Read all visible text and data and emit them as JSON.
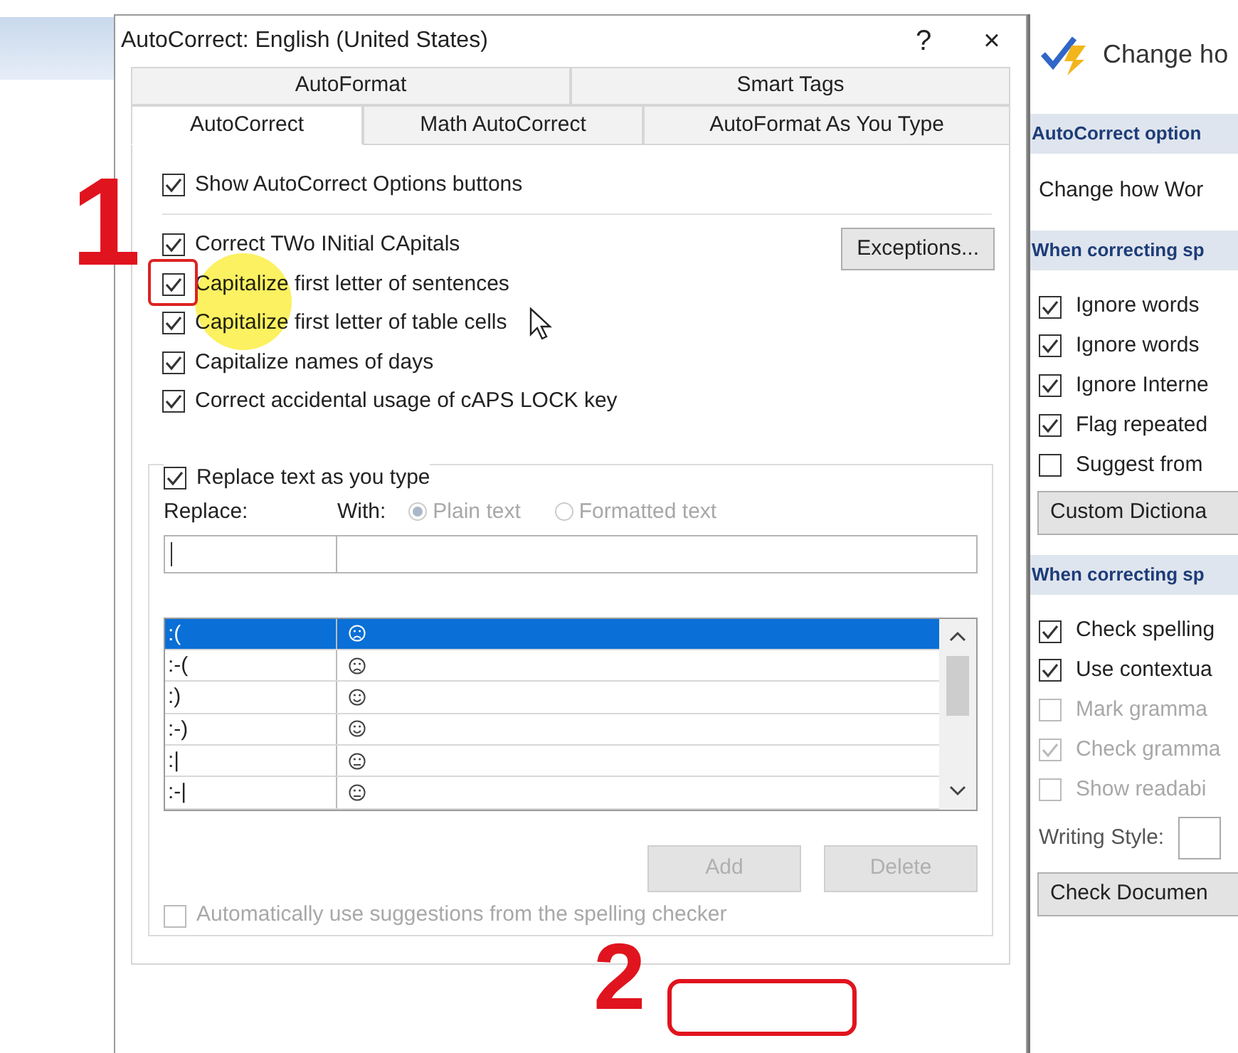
{
  "window": {
    "title": "AutoCorrect: English (United States)",
    "help": "?",
    "close": "×"
  },
  "tabs_back": [
    {
      "label": "AutoFormat",
      "selected": false
    },
    {
      "label": "Smart Tags",
      "selected": false
    }
  ],
  "tabs_front": [
    {
      "label": "AutoCorrect",
      "selected": true
    },
    {
      "label": "Math AutoCorrect",
      "selected": false
    },
    {
      "label": "AutoFormat As You Type",
      "selected": false
    }
  ],
  "show_options": {
    "label": "Show AutoCorrect Options buttons",
    "checked": true
  },
  "options": [
    {
      "label": "Correct TWo INitial CApitals",
      "checked": true,
      "highlighted": false
    },
    {
      "label": "Capitalize first letter of sentences",
      "checked": true,
      "highlighted": true
    },
    {
      "label": "Capitalize first letter of table cells",
      "checked": true,
      "highlighted": false
    },
    {
      "label": "Capitalize names of days",
      "checked": true,
      "highlighted": false
    },
    {
      "label": "Correct accidental usage of cAPS LOCK key",
      "checked": true,
      "highlighted": false
    }
  ],
  "exceptions_button": "Exceptions...",
  "replace_group": {
    "label": "Replace text as you type",
    "checked": true,
    "replace_label": "Replace:",
    "with_label": "With:",
    "formats": [
      {
        "label": "Plain text",
        "selected": true
      },
      {
        "label": "Formatted text",
        "selected": false
      }
    ]
  },
  "entries": [
    {
      "replace": ":(",
      "kind": "frown",
      "selected": true
    },
    {
      "replace": ":-(",
      "kind": "frown",
      "selected": false
    },
    {
      "replace": ":)",
      "kind": "smile",
      "selected": false
    },
    {
      "replace": ":-)",
      "kind": "smile",
      "selected": false
    },
    {
      "replace": ":|",
      "kind": "neutral",
      "selected": false
    },
    {
      "replace": ":-|",
      "kind": "neutral",
      "selected": false
    }
  ],
  "buttons": [
    {
      "label": "Add",
      "disabled": true
    },
    {
      "label": "Delete",
      "disabled": true
    }
  ],
  "auto_suggest": {
    "label": "Automatically use suggestions from the spelling checker",
    "checked": false,
    "disabled": true
  },
  "markers": [
    {
      "label": "1"
    },
    {
      "label": "2"
    }
  ],
  "side_panel": {
    "title": "Change ho",
    "items": [
      {
        "kind": "heading",
        "label": "AutoCorrect option"
      },
      {
        "kind": "text",
        "label": "Change how Wor"
      },
      {
        "kind": "heading",
        "label": "When correcting sp"
      },
      {
        "kind": "checkbox",
        "label": "Ignore words",
        "checked": true,
        "disabled": false
      },
      {
        "kind": "checkbox",
        "label": "Ignore words",
        "checked": true,
        "disabled": false
      },
      {
        "kind": "checkbox",
        "label": "Ignore Interne",
        "checked": true,
        "disabled": false
      },
      {
        "kind": "checkbox",
        "label": "Flag repeated",
        "checked": true,
        "disabled": false
      },
      {
        "kind": "checkbox",
        "label": "Suggest from",
        "checked": false,
        "disabled": false
      },
      {
        "kind": "button",
        "label": "Custom Dictiona"
      },
      {
        "kind": "heading",
        "label": "When correcting sp"
      },
      {
        "kind": "checkbox",
        "label": "Check spelling",
        "checked": true,
        "disabled": false
      },
      {
        "kind": "checkbox",
        "label": "Use contextua",
        "checked": true,
        "disabled": false
      },
      {
        "kind": "checkbox",
        "label": "Mark gramma",
        "checked": false,
        "disabled": true
      },
      {
        "kind": "checkbox",
        "label": "Check gramma",
        "checked": true,
        "disabled": true
      },
      {
        "kind": "checkbox",
        "label": "Show readabi",
        "checked": false,
        "disabled": true
      },
      {
        "kind": "field",
        "label": "Writing Style:"
      },
      {
        "kind": "button",
        "label": "Check Documen"
      }
    ]
  }
}
